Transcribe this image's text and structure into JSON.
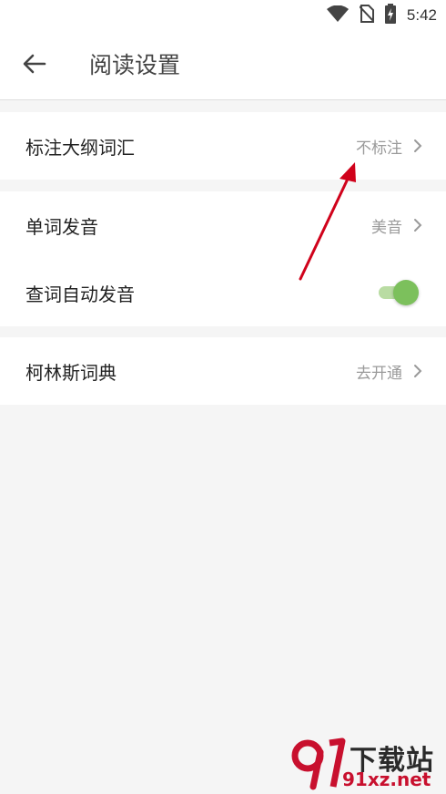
{
  "status_bar": {
    "time": "5:42",
    "icons": [
      "wifi-icon",
      "no-sim-icon",
      "battery-charging-icon"
    ]
  },
  "header": {
    "back_icon": "arrow-left-icon",
    "title": "阅读设置"
  },
  "groups": [
    {
      "rows": [
        {
          "label": "标注大纲词汇",
          "value": "不标注",
          "type": "navigate"
        }
      ]
    },
    {
      "rows": [
        {
          "label": "单词发音",
          "value": "美音",
          "type": "navigate"
        },
        {
          "label": "查词自动发音",
          "type": "toggle",
          "toggle_on": true
        }
      ]
    },
    {
      "rows": [
        {
          "label": "柯林斯词典",
          "value": "去开通",
          "type": "navigate"
        }
      ]
    }
  ],
  "annotation": {
    "type": "arrow",
    "color": "#d0021b"
  },
  "watermark": {
    "brand_text": "下载站",
    "url": "91xz.net",
    "logo_icon": "91-logo-icon"
  },
  "colors": {
    "toggle_thumb": "#7cc05c",
    "toggle_track": "#b9dca3",
    "background": "#f5f5f5",
    "annotation": "#d0021b"
  }
}
